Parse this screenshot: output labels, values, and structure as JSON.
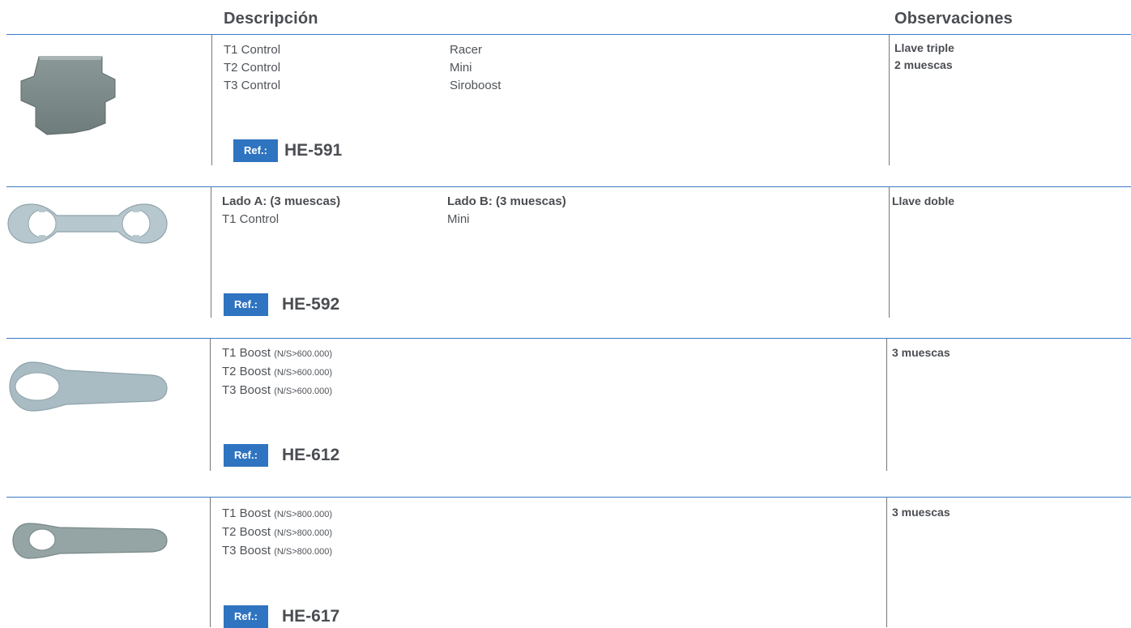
{
  "header": {
    "description": "Descripción",
    "observations": "Observaciones"
  },
  "rows": [
    {
      "col1": [
        "T1 Control",
        "T2 Control",
        "T3 Control"
      ],
      "col2": [
        "Racer",
        "Mini",
        "Siroboost"
      ],
      "obs": [
        "Llave triple",
        "2 muescas"
      ],
      "ref_label": "Ref.:",
      "ref_code": "HE-591"
    },
    {
      "col1_head": "Lado A: (3 muescas)",
      "col1": [
        "T1 Control"
      ],
      "col2_head": "Lado B: (3 muescas)",
      "col2": [
        "Mini"
      ],
      "obs": [
        "Llave doble"
      ],
      "ref_label": "Ref.:",
      "ref_code": "HE-592"
    },
    {
      "col1": [
        {
          "main": "T1 Boost",
          "note": "(N/S>600.000)"
        },
        {
          "main": "T2 Boost",
          "note": "(N/S>600.000)"
        },
        {
          "main": "T3 Boost",
          "note": "(N/S>600.000)"
        }
      ],
      "obs": [
        "3 muescas"
      ],
      "ref_label": "Ref.:",
      "ref_code": "HE-612"
    },
    {
      "col1": [
        {
          "main": "T1 Boost",
          "note": "(N/S>800.000)"
        },
        {
          "main": "T2 Boost",
          "note": "(N/S>800.000)"
        },
        {
          "main": "T3 Boost",
          "note": "(N/S>800.000)"
        }
      ],
      "obs": [
        "3 muescas"
      ],
      "ref_label": "Ref.:",
      "ref_code": "HE-617"
    }
  ]
}
